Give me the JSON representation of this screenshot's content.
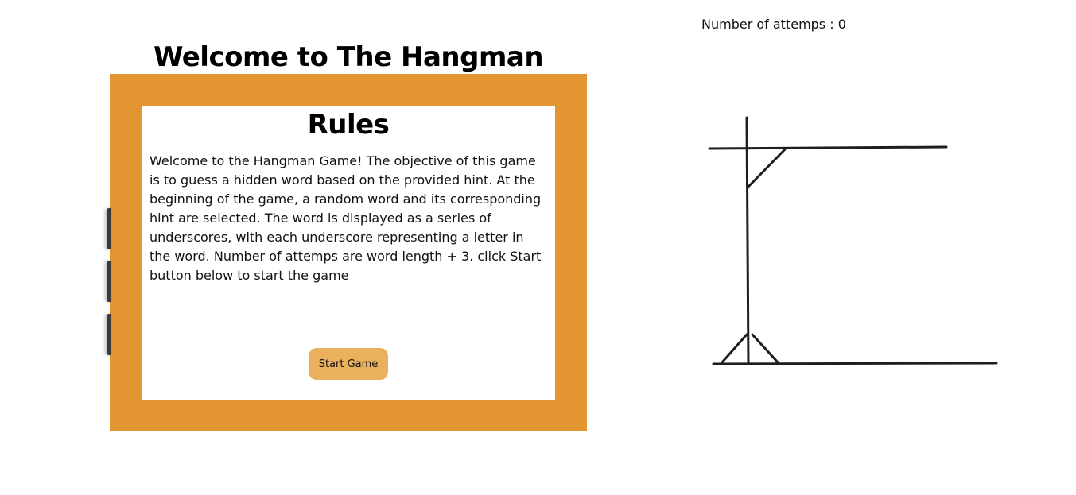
{
  "header": {
    "title": "Welcome to The Hangman Game"
  },
  "status": {
    "attempts_text": "Number of attemps : 0"
  },
  "rules": {
    "heading": "Rules",
    "body": "Welcome to the Hangman Game! The objective of this game is to guess a hidden word based on the provided hint. At the beginning of the game, a random word and its corresponding hint are selected. The word is displayed as a series of underscores, with each underscore representing a letter in the word. Number of attemps are word length + 3. click Start button below to start the game",
    "start_button_label": "Start Game"
  },
  "colors": {
    "frame": "#e29530",
    "button": "#eab15d",
    "card": "#ffffff",
    "line": "#1e1e1e"
  },
  "icons": {
    "gallows": "gallows-drawing"
  }
}
